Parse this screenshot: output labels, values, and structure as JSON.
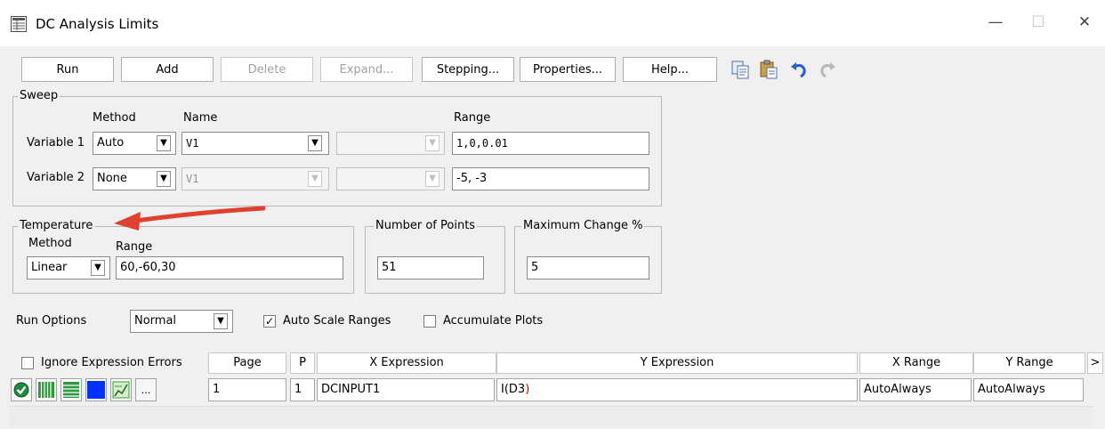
{
  "window": {
    "title": "DC Analysis Limits",
    "minimize": "—",
    "maximize": "☐",
    "close": "✕"
  },
  "toolbar": {
    "run": "Run",
    "add": "Add",
    "delete": "Delete",
    "expand": "Expand...",
    "stepping": "Stepping...",
    "properties": "Properties...",
    "help": "Help...",
    "icons": [
      "copy-icon",
      "paste-icon",
      "undo-icon",
      "redo-icon"
    ]
  },
  "sweep": {
    "legend": "Sweep",
    "col_method": "Method",
    "col_name": "Name",
    "col_range": "Range",
    "var1": {
      "label": "Variable 1",
      "method": "Auto",
      "name": "V1",
      "name2": "",
      "range": "1,0,0.01"
    },
    "var2": {
      "label": "Variable 2",
      "method": "None",
      "name": "V1",
      "name2": "",
      "range": "-5, -3"
    }
  },
  "temperature": {
    "legend": "Temperature",
    "col_method": "Method",
    "col_range": "Range",
    "method": "Linear",
    "range": "60,-60,30"
  },
  "points": {
    "legend": "Number of Points",
    "value": "51"
  },
  "max_change": {
    "legend": "Maximum Change %",
    "value": "5"
  },
  "run_options": {
    "label": "Run Options",
    "value": "Normal",
    "auto_scale_label": "Auto Scale Ranges",
    "auto_scale_checked": "✓",
    "accumulate_label": "Accumulate Plots",
    "accumulate_checked": ""
  },
  "grid": {
    "ignore_errors_label": "Ignore Expression Errors",
    "ignore_errors_checked": "",
    "headers": {
      "page": "Page",
      "p": "P",
      "x_expr": "X Expression",
      "y_expr": "Y Expression",
      "x_range": "X Range",
      "y_range": "Y Range",
      "more": ">"
    },
    "row": {
      "more_button": "...",
      "page": "1",
      "p": "1",
      "x_expr": "DCINPUT1",
      "y_expr_prefix": "I(D3",
      "y_expr_suffix": ")",
      "x_range": "AutoAlways",
      "y_range": "AutoAlways"
    }
  },
  "colors": {
    "annotation_arrow": "#e0402e",
    "plot_color": "#0033ff",
    "y_expr_paren": "#c00000"
  }
}
